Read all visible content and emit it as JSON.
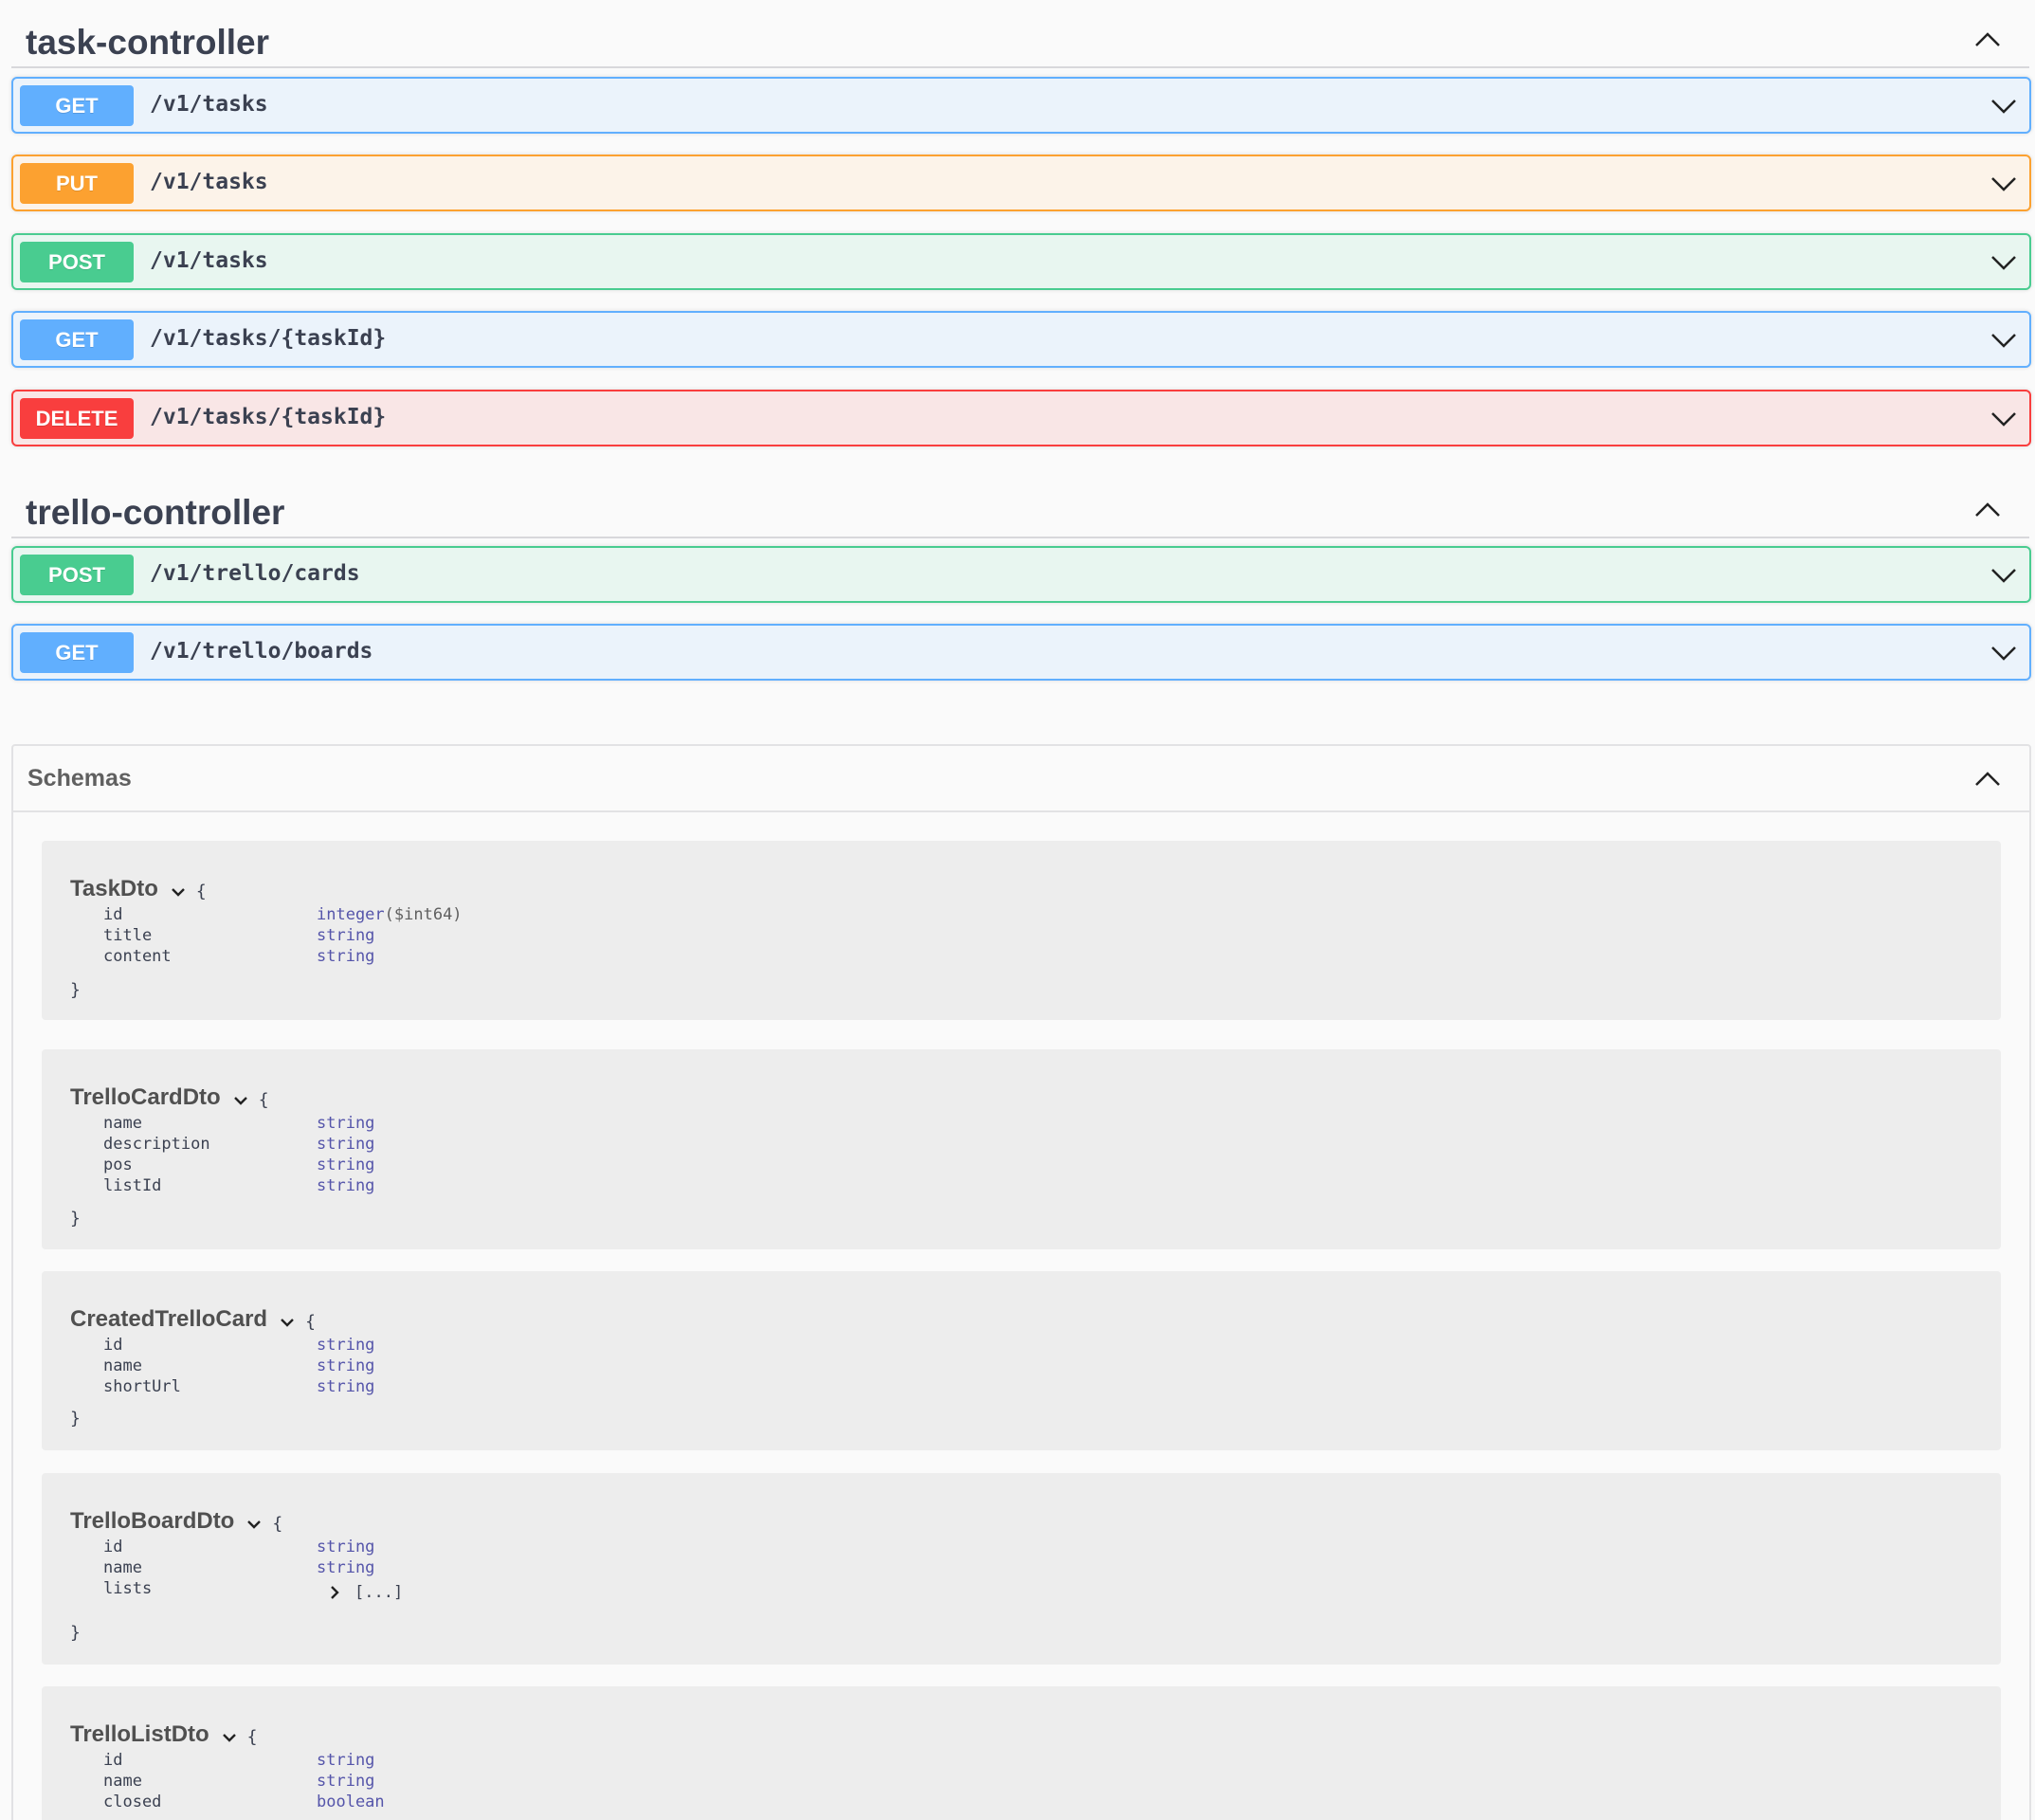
{
  "task_controller": {
    "title": "task-controller",
    "operations": [
      {
        "method": "GET",
        "path": "/v1/tasks"
      },
      {
        "method": "PUT",
        "path": "/v1/tasks"
      },
      {
        "method": "POST",
        "path": "/v1/tasks"
      },
      {
        "method": "GET",
        "path": "/v1/tasks/{taskId}"
      },
      {
        "method": "DELETE",
        "path": "/v1/tasks/{taskId}"
      }
    ]
  },
  "trello_controller": {
    "title": "trello-controller",
    "operations": [
      {
        "method": "POST",
        "path": "/v1/trello/cards"
      },
      {
        "method": "GET",
        "path": "/v1/trello/boards"
      }
    ]
  },
  "schemas": {
    "title": "Schemas",
    "open_brace": "{",
    "close_brace": "}",
    "models": [
      {
        "name": "TaskDto",
        "properties": [
          {
            "name": "id",
            "type": "integer",
            "format": "($int64)"
          },
          {
            "name": "title",
            "type": "string"
          },
          {
            "name": "content",
            "type": "string"
          }
        ]
      },
      {
        "name": "TrelloCardDto",
        "properties": [
          {
            "name": "name",
            "type": "string"
          },
          {
            "name": "description",
            "type": "string"
          },
          {
            "name": "pos",
            "type": "string"
          },
          {
            "name": "listId",
            "type": "string"
          }
        ]
      },
      {
        "name": "CreatedTrelloCard",
        "properties": [
          {
            "name": "id",
            "type": "string"
          },
          {
            "name": "name",
            "type": "string"
          },
          {
            "name": "shortUrl",
            "type": "string"
          }
        ]
      },
      {
        "name": "TrelloBoardDto",
        "properties": [
          {
            "name": "id",
            "type": "string"
          },
          {
            "name": "name",
            "type": "string"
          },
          {
            "name": "lists",
            "type": "[...]"
          }
        ]
      },
      {
        "name": "TrelloListDto",
        "properties": [
          {
            "name": "id",
            "type": "string"
          },
          {
            "name": "name",
            "type": "string"
          },
          {
            "name": "closed",
            "type": "boolean"
          }
        ]
      }
    ]
  },
  "colors": {
    "get": "#61affe",
    "put": "#fca130",
    "post": "#49cc90",
    "delete": "#f93e3e"
  },
  "icons": {
    "section_toggle": "chevron-up-icon",
    "operation_toggle": "chevron-down-icon",
    "model_toggle": "chevron-down-icon",
    "array_toggle": "chevron-right-icon"
  }
}
